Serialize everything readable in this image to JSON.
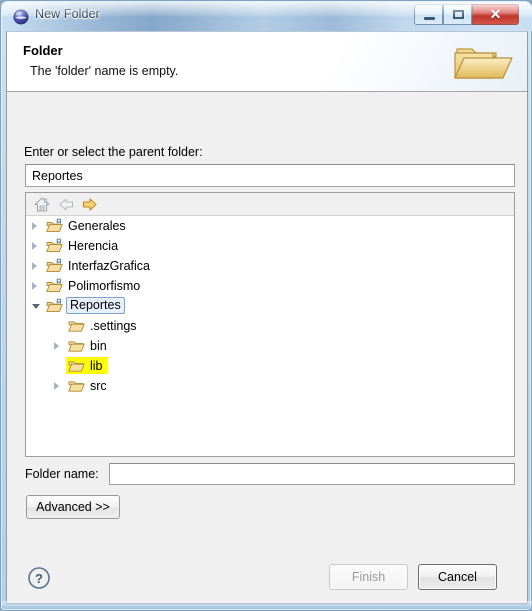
{
  "window": {
    "title": "New Folder",
    "icon": "eclipse-sphere-icon",
    "buttons": {
      "minimize": "minimize-icon",
      "maximize": "maximize-icon",
      "close": "✕"
    }
  },
  "header": {
    "title": "Folder",
    "message": "The 'folder' name is empty.",
    "image": "open-folder-image"
  },
  "body": {
    "parent_label": "Enter or select the parent folder:",
    "parent_value": "Reportes",
    "parent_placeholder": "",
    "toolbar": {
      "home": "home-icon",
      "back": "back-arrow-icon",
      "forward": "forward-arrow-icon"
    },
    "tree": [
      {
        "label": "Generales",
        "depth": 0,
        "twisty": "closed",
        "icon": "project-folder-icon",
        "state": "normal"
      },
      {
        "label": "Herencia",
        "depth": 0,
        "twisty": "closed",
        "icon": "project-folder-icon",
        "state": "normal"
      },
      {
        "label": "InterfazGrafica",
        "depth": 0,
        "twisty": "closed",
        "icon": "project-folder-icon",
        "state": "normal"
      },
      {
        "label": "Polimorfismo",
        "depth": 0,
        "twisty": "closed",
        "icon": "project-folder-icon",
        "state": "normal"
      },
      {
        "label": "Reportes",
        "depth": 0,
        "twisty": "open",
        "icon": "project-folder-icon",
        "state": "selected"
      },
      {
        "label": ".settings",
        "depth": 1,
        "twisty": "none",
        "icon": "folder-icon",
        "state": "normal"
      },
      {
        "label": "bin",
        "depth": 1,
        "twisty": "closed",
        "icon": "folder-icon",
        "state": "normal"
      },
      {
        "label": "lib",
        "depth": 1,
        "twisty": "none",
        "icon": "folder-icon",
        "state": "highlighted"
      },
      {
        "label": "src",
        "depth": 1,
        "twisty": "closed",
        "icon": "folder-icon",
        "state": "normal"
      }
    ],
    "foldername_label": "Folder name:",
    "foldername_value": "",
    "foldername_placeholder": "",
    "advanced_label": "Advanced >>"
  },
  "footer": {
    "help": "help-icon",
    "finish_label": "Finish",
    "finish_enabled": false,
    "cancel_label": "Cancel",
    "cancel_enabled": true
  },
  "colors": {
    "highlight_yellow": "#ffff00",
    "selection_blue": "#7da2ce",
    "close_red": "#bc2f26",
    "folder_gold": "#e8c06a",
    "dialog_gray": "#f0f0f0"
  }
}
